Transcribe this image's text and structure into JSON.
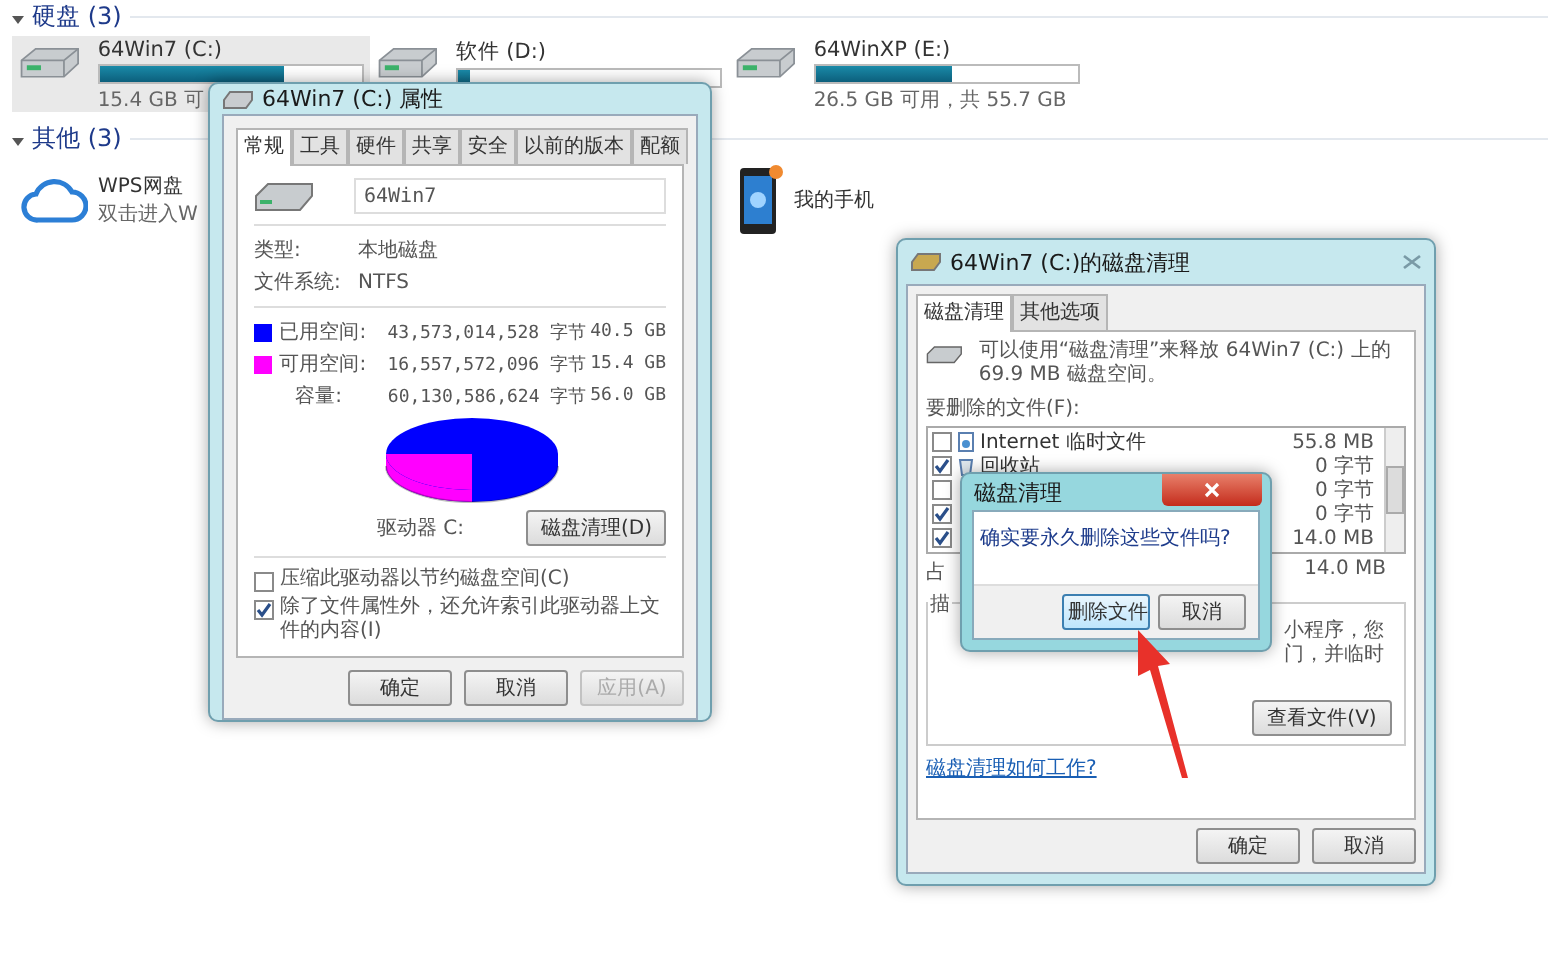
{
  "explorer": {
    "sections": [
      {
        "title": "硬盘 (3)",
        "expanded": true,
        "drives": [
          {
            "name": "64Win7  (C:)",
            "free": "15.4 GB 可",
            "level": 0.7,
            "selected": true
          },
          {
            "name": "软件 (D:)",
            "level": 0.05,
            "selected": false
          },
          {
            "name": "64WinXP  (E:)",
            "free": "26.5 GB 可用，共 55.7 GB",
            "level": 0.52,
            "selected": false
          }
        ]
      },
      {
        "title": "其他 (3)",
        "expanded": true,
        "items": [
          {
            "kind": "cloud",
            "name": "WPS网盘",
            "subtitle": "双击进入W"
          },
          {
            "kind": "phone",
            "name": "我的手机"
          }
        ]
      }
    ]
  },
  "properties": {
    "title": "64Win7 (C:) 属性",
    "tabs": [
      {
        "label": "常规",
        "selected": true
      },
      {
        "label": "工具",
        "selected": false
      },
      {
        "label": "硬件",
        "selected": false
      },
      {
        "label": "共享",
        "selected": false
      },
      {
        "label": "安全",
        "selected": false
      },
      {
        "label": "以前的版本",
        "selected": false
      },
      {
        "label": "配额",
        "selected": false
      }
    ],
    "name_field": {
      "value": "64Win7"
    },
    "info": [
      {
        "label": "类型:",
        "value": "本地磁盘"
      },
      {
        "label": "文件系统:",
        "value": "NTFS"
      }
    ],
    "usage": [
      {
        "label": "已用空间:",
        "bytes": "43,573,014,528 字节",
        "size": "40.5 GB",
        "color": "#0000ff"
      },
      {
        "label": "可用空间:",
        "bytes": "16,557,572,096 字节",
        "size": "15.4 GB",
        "color": "#ff00ff"
      }
    ],
    "capacity": {
      "label": "容量:",
      "bytes": "60,130,586,624 字节",
      "size": "56.0 GB"
    },
    "drive_label": "驱动器 C:",
    "cleanup_button": "磁盘清理(D)",
    "options": [
      {
        "label": "压缩此驱动器以节约磁盘空间(C)",
        "checked": false
      },
      {
        "label": "除了文件属性外，还允许索引此驱动器上文件的内容(I)",
        "checked": true
      }
    ],
    "buttons": [
      {
        "label": "确定",
        "disabled": false
      },
      {
        "label": "取消",
        "disabled": false
      },
      {
        "label": "应用(A)",
        "disabled": true
      }
    ]
  },
  "cleanup": {
    "title": "64Win7 (C:)的磁盘清理",
    "tabs": [
      {
        "label": "磁盘清理",
        "selected": true
      },
      {
        "label": "其他选项",
        "selected": false
      }
    ],
    "intro": "可以使用“磁盘清理”来释放 64Win7 (C:) 上的 69.9 MB 磁盘空间。",
    "files_label": "要删除的文件(F):",
    "files": [
      {
        "kind": "internet",
        "name": "Internet 临时文件",
        "size": "55.8 MB",
        "checked": false
      },
      {
        "kind": "recycle",
        "name": "回收站",
        "size": "0 字节",
        "checked": true
      },
      {
        "size": "0 字节",
        "checked": false
      },
      {
        "size": "0 字节",
        "checked": true
      },
      {
        "size": "14.0 MB",
        "checked": true
      }
    ],
    "total": {
      "label": "占",
      "value": "14.0 MB"
    },
    "description": {
      "label": "描",
      "lines": [
        "小程序，您",
        "门，并临时"
      ]
    },
    "view_button": "查看文件(V)",
    "help_link": "磁盘清理如何工作?",
    "buttons": [
      "确定",
      "取消"
    ]
  },
  "confirm": {
    "title": "磁盘清理",
    "message": "确实要永久删除这些文件吗?",
    "buttons": [
      {
        "label": "删除文件",
        "focused": true
      },
      {
        "label": "取消",
        "focused": false
      }
    ]
  }
}
